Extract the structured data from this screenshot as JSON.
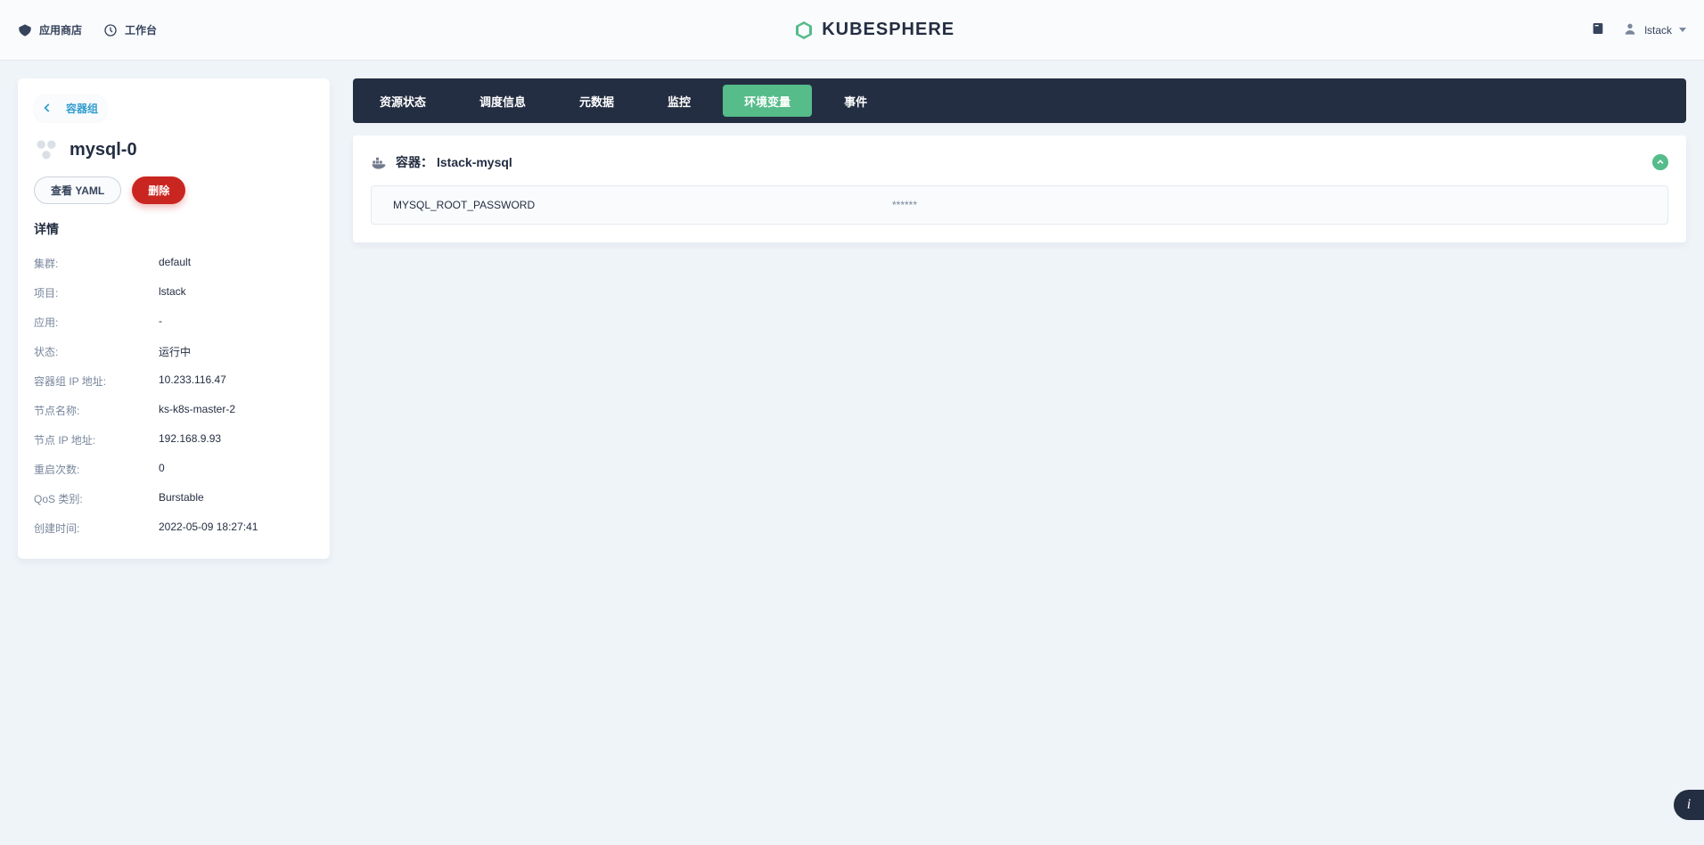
{
  "topbar": {
    "app_store": "应用商店",
    "workbench": "工作台",
    "brand": "KUBESPHERE",
    "username": "lstack"
  },
  "side": {
    "back_label": "容器组",
    "title": "mysql-0",
    "view_yaml": "查看 YAML",
    "delete": "删除",
    "details_heading": "详情",
    "rows": [
      {
        "label": "集群:",
        "value": "default"
      },
      {
        "label": "项目:",
        "value": "lstack"
      },
      {
        "label": "应用:",
        "value": "-"
      },
      {
        "label": "状态:",
        "value": "运行中"
      },
      {
        "label": "容器组 IP 地址:",
        "value": "10.233.116.47"
      },
      {
        "label": "节点名称:",
        "value": "ks-k8s-master-2"
      },
      {
        "label": "节点 IP 地址:",
        "value": "192.168.9.93"
      },
      {
        "label": "重启次数:",
        "value": "0"
      },
      {
        "label": "QoS 类别:",
        "value": "Burstable"
      },
      {
        "label": "创建时间:",
        "value": "2022-05-09 18:27:41"
      }
    ]
  },
  "tabs": {
    "resource_status": "资源状态",
    "scheduling": "调度信息",
    "metadata": "元数据",
    "monitoring": "监控",
    "env_vars": "环境变量",
    "events": "事件"
  },
  "container": {
    "label_prefix": "容器：",
    "name": "lstack-mysql",
    "env": [
      {
        "key": "MYSQL_ROOT_PASSWORD",
        "value": "******"
      }
    ]
  }
}
